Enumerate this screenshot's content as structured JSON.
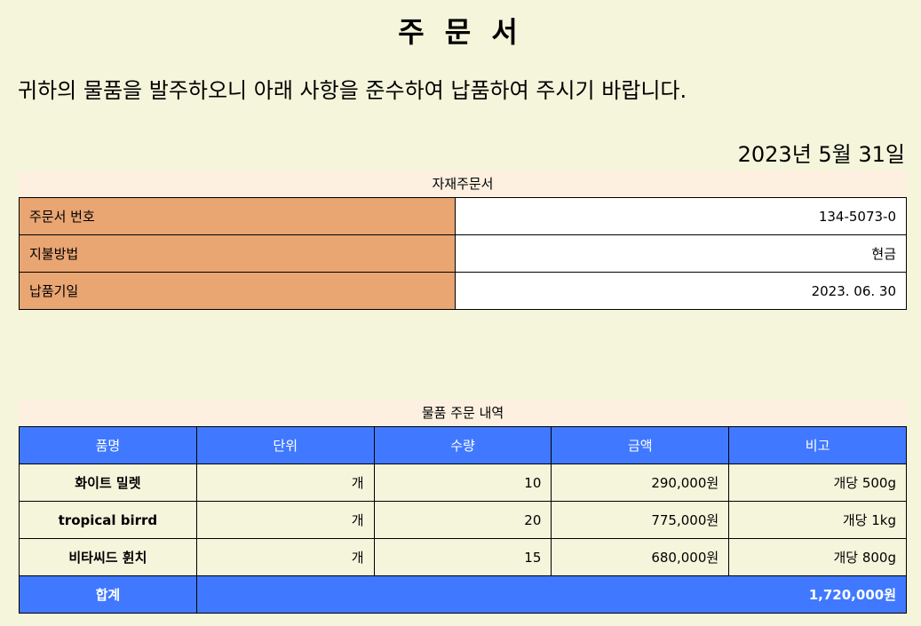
{
  "title": "주 문 서",
  "intro": "귀하의 물품을 발주하오니 아래 사항을 준수하여 납품하여 주시기 바랍니다.",
  "date": "2023년 5월 31일",
  "info": {
    "caption": "자재주문서",
    "rows": [
      {
        "label": "주문서 번호",
        "value": "134-5073-0"
      },
      {
        "label": "지불방법",
        "value": "현금"
      },
      {
        "label": "납품기일",
        "value": "2023. 06. 30"
      }
    ]
  },
  "items": {
    "caption": "물품 주문 내역",
    "headers": [
      "품명",
      "단위",
      "수량",
      "금액",
      "비고"
    ],
    "rows": [
      {
        "name": "화이트 밀렛",
        "unit": "개",
        "qty": "10",
        "amount": "290,000원",
        "note": "개당 500g"
      },
      {
        "name": "tropical birrd",
        "unit": "개",
        "qty": "20",
        "amount": "775,000원",
        "note": "개당 1kg"
      },
      {
        "name": "비타씨드 휜치",
        "unit": "개",
        "qty": "15",
        "amount": "680,000원",
        "note": "개당 800g"
      }
    ],
    "total_label": "합계",
    "total_value": "1,720,000원"
  },
  "colors": {
    "background": "#f5f5dc",
    "caption_bg": "#fdf0e0",
    "info_label_bg": "#e9a572",
    "header_bg": "#4079ff"
  }
}
